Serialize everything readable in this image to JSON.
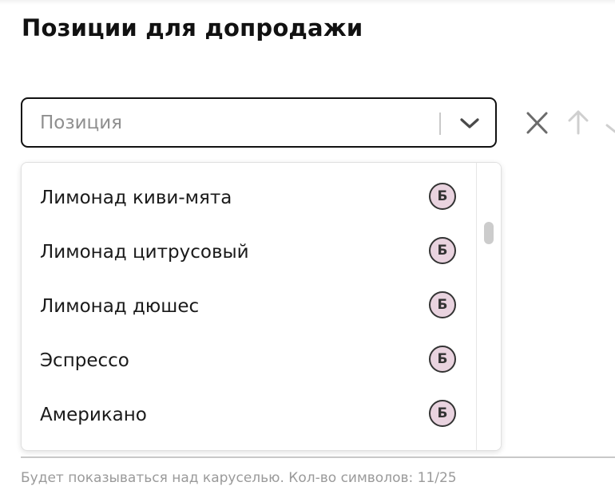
{
  "section": {
    "title": "Позиции для допродажи"
  },
  "select": {
    "placeholder": "Позиция"
  },
  "options": [
    {
      "label": "Лимонад киви-мята",
      "badge": "Б"
    },
    {
      "label": "Лимонад цитрусовый",
      "badge": "Б"
    },
    {
      "label": "Лимонад дюшес",
      "badge": "Б"
    },
    {
      "label": "Эспрессо",
      "badge": "Б"
    },
    {
      "label": "Американо",
      "badge": "Б"
    }
  ],
  "icons": {
    "chevron": "chevron-down-icon",
    "remove": "close-icon",
    "move_up": "arrow-up-icon",
    "move_down": "arrow-down-icon"
  },
  "helper": {
    "text": "Будет показываться над каруселью. Кол-во символов: 11/25"
  },
  "colors": {
    "badge_bg": "#e9d3df",
    "border": "#111111",
    "placeholder": "#8f8f8f"
  }
}
